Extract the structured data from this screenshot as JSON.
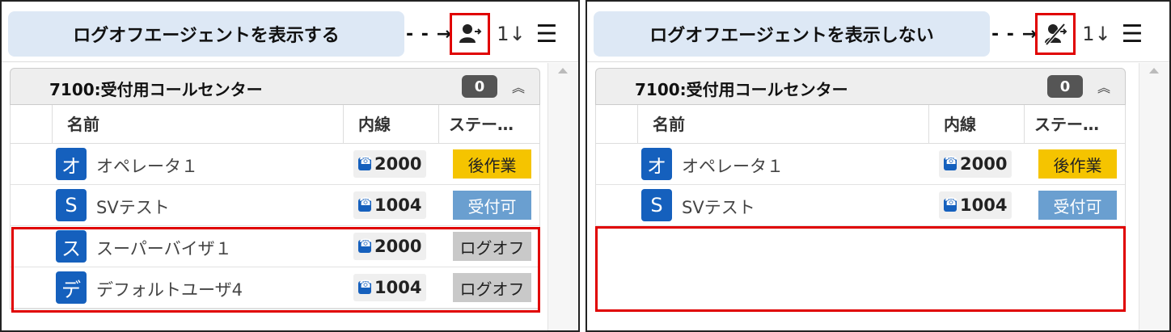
{
  "left": {
    "callout": "ログオフエージェントを表示する",
    "arrow": "- - →",
    "toggle_icon": "show-logoff-agents-icon",
    "sort_icon_text": "1↓",
    "group": {
      "name": "7100:受付用コールセンター",
      "count": "0"
    },
    "headers": {
      "name": "名前",
      "extension": "内線",
      "status": "ステー…"
    },
    "rows": [
      {
        "initial": "オ",
        "name": "オペレータ１",
        "ext": "2000",
        "status": "後作業",
        "status_type": "after"
      },
      {
        "initial": "S",
        "name": "SVテスト",
        "ext": "1004",
        "status": "受付可",
        "status_type": "avail"
      },
      {
        "initial": "ス",
        "name": "スーパーバイザ１",
        "ext": "2000",
        "status": "ログオフ",
        "status_type": "off"
      },
      {
        "initial": "デ",
        "name": "デフォルトユーザ4",
        "ext": "1004",
        "status": "ログオフ",
        "status_type": "off"
      }
    ]
  },
  "right": {
    "callout": "ログオフエージェントを表示しない",
    "arrow": "- - →",
    "toggle_icon": "hide-logoff-agents-icon",
    "sort_icon_text": "1↓",
    "group": {
      "name": "7100:受付用コールセンター",
      "count": "0"
    },
    "headers": {
      "name": "名前",
      "extension": "内線",
      "status": "ステー…"
    },
    "rows": [
      {
        "initial": "オ",
        "name": "オペレータ１",
        "ext": "2000",
        "status": "後作業",
        "status_type": "after"
      },
      {
        "initial": "S",
        "name": "SVテスト",
        "ext": "1004",
        "status": "受付可",
        "status_type": "avail"
      }
    ]
  },
  "colors": {
    "avatar": "#1560bd",
    "status_after": "#f5c400",
    "status_available": "#6a9fd0",
    "status_logoff": "#c9c9c9",
    "highlight": "#e00000"
  }
}
